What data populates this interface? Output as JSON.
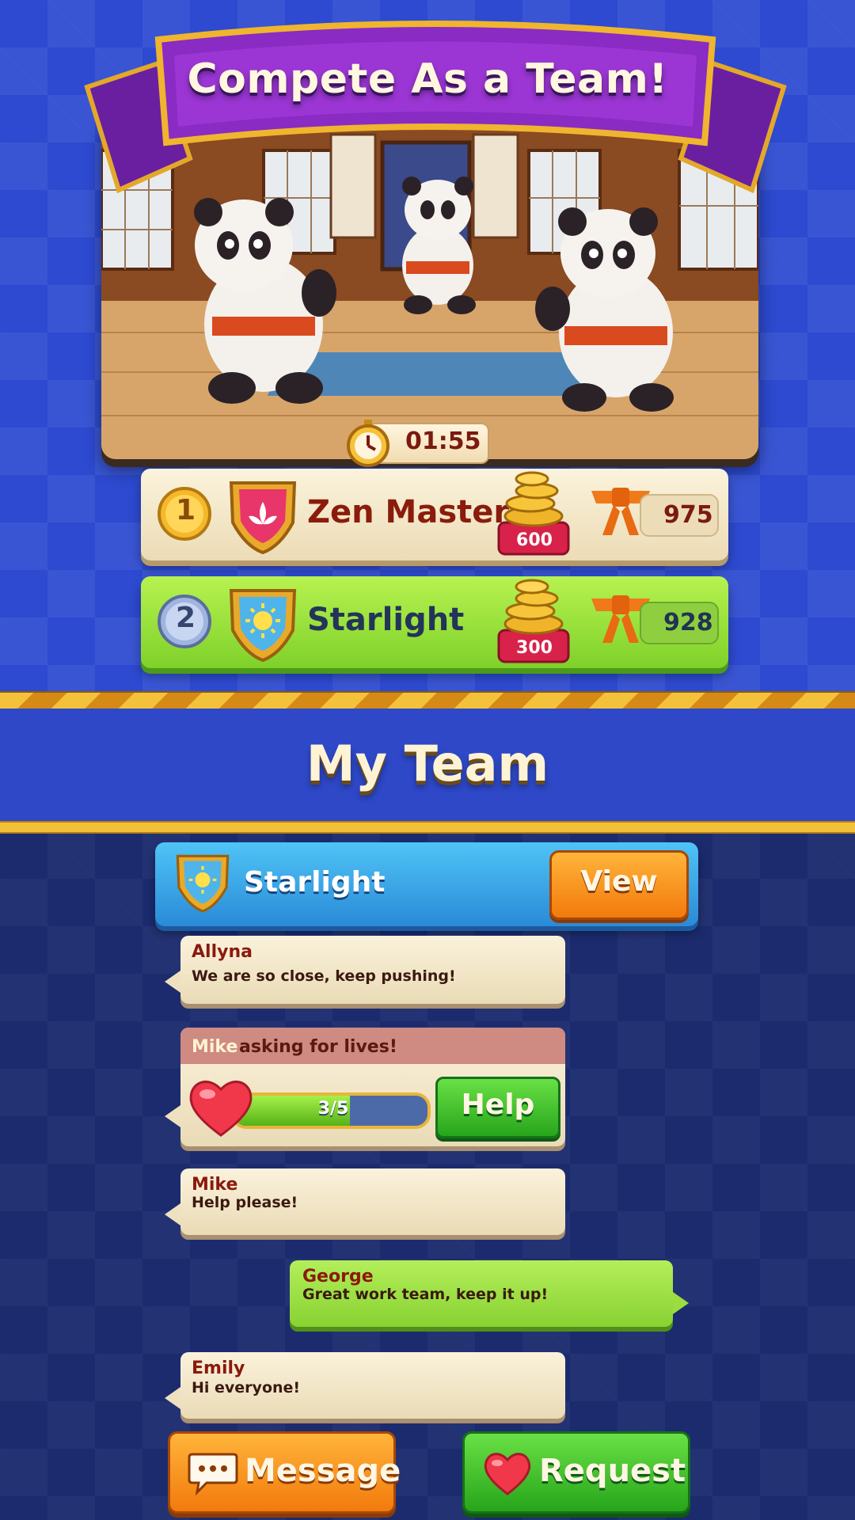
{
  "banner": {
    "title": "Compete As a Team!"
  },
  "timer": {
    "value": "01:55",
    "icon": "stopwatch-icon"
  },
  "leaderboard": [
    {
      "rank": "1",
      "team": "Zen Masters",
      "crest": "lotus-shield-icon",
      "coin_reward": "600",
      "score": "975"
    },
    {
      "rank": "2",
      "team": "Starlight",
      "crest": "sun-shield-icon",
      "coin_reward": "300",
      "score": "928"
    }
  ],
  "section": {
    "title": "My Team"
  },
  "my_team": {
    "name": "Starlight",
    "view_label": "View"
  },
  "chat": [
    {
      "sender": "Allyna",
      "text": "We are so close, keep pushing!"
    },
    {
      "type": "request",
      "sender": "Mike",
      "text": "asking for lives!",
      "progress": "3/5",
      "progress_fraction": 0.6,
      "button": "Help"
    },
    {
      "sender": "Mike",
      "text": "Help please!"
    },
    {
      "sender": "George",
      "text": "Great work team, keep it up!"
    },
    {
      "sender": "Emily",
      "text": "Hi everyone!"
    }
  ],
  "actions": {
    "message_label": "Message",
    "request_label": "Request"
  },
  "colors": {
    "accent_orange": "#f27a0c",
    "accent_green": "#27a51b",
    "brand_purple": "#7a22b8",
    "background_blue": "#2d4ad0"
  }
}
